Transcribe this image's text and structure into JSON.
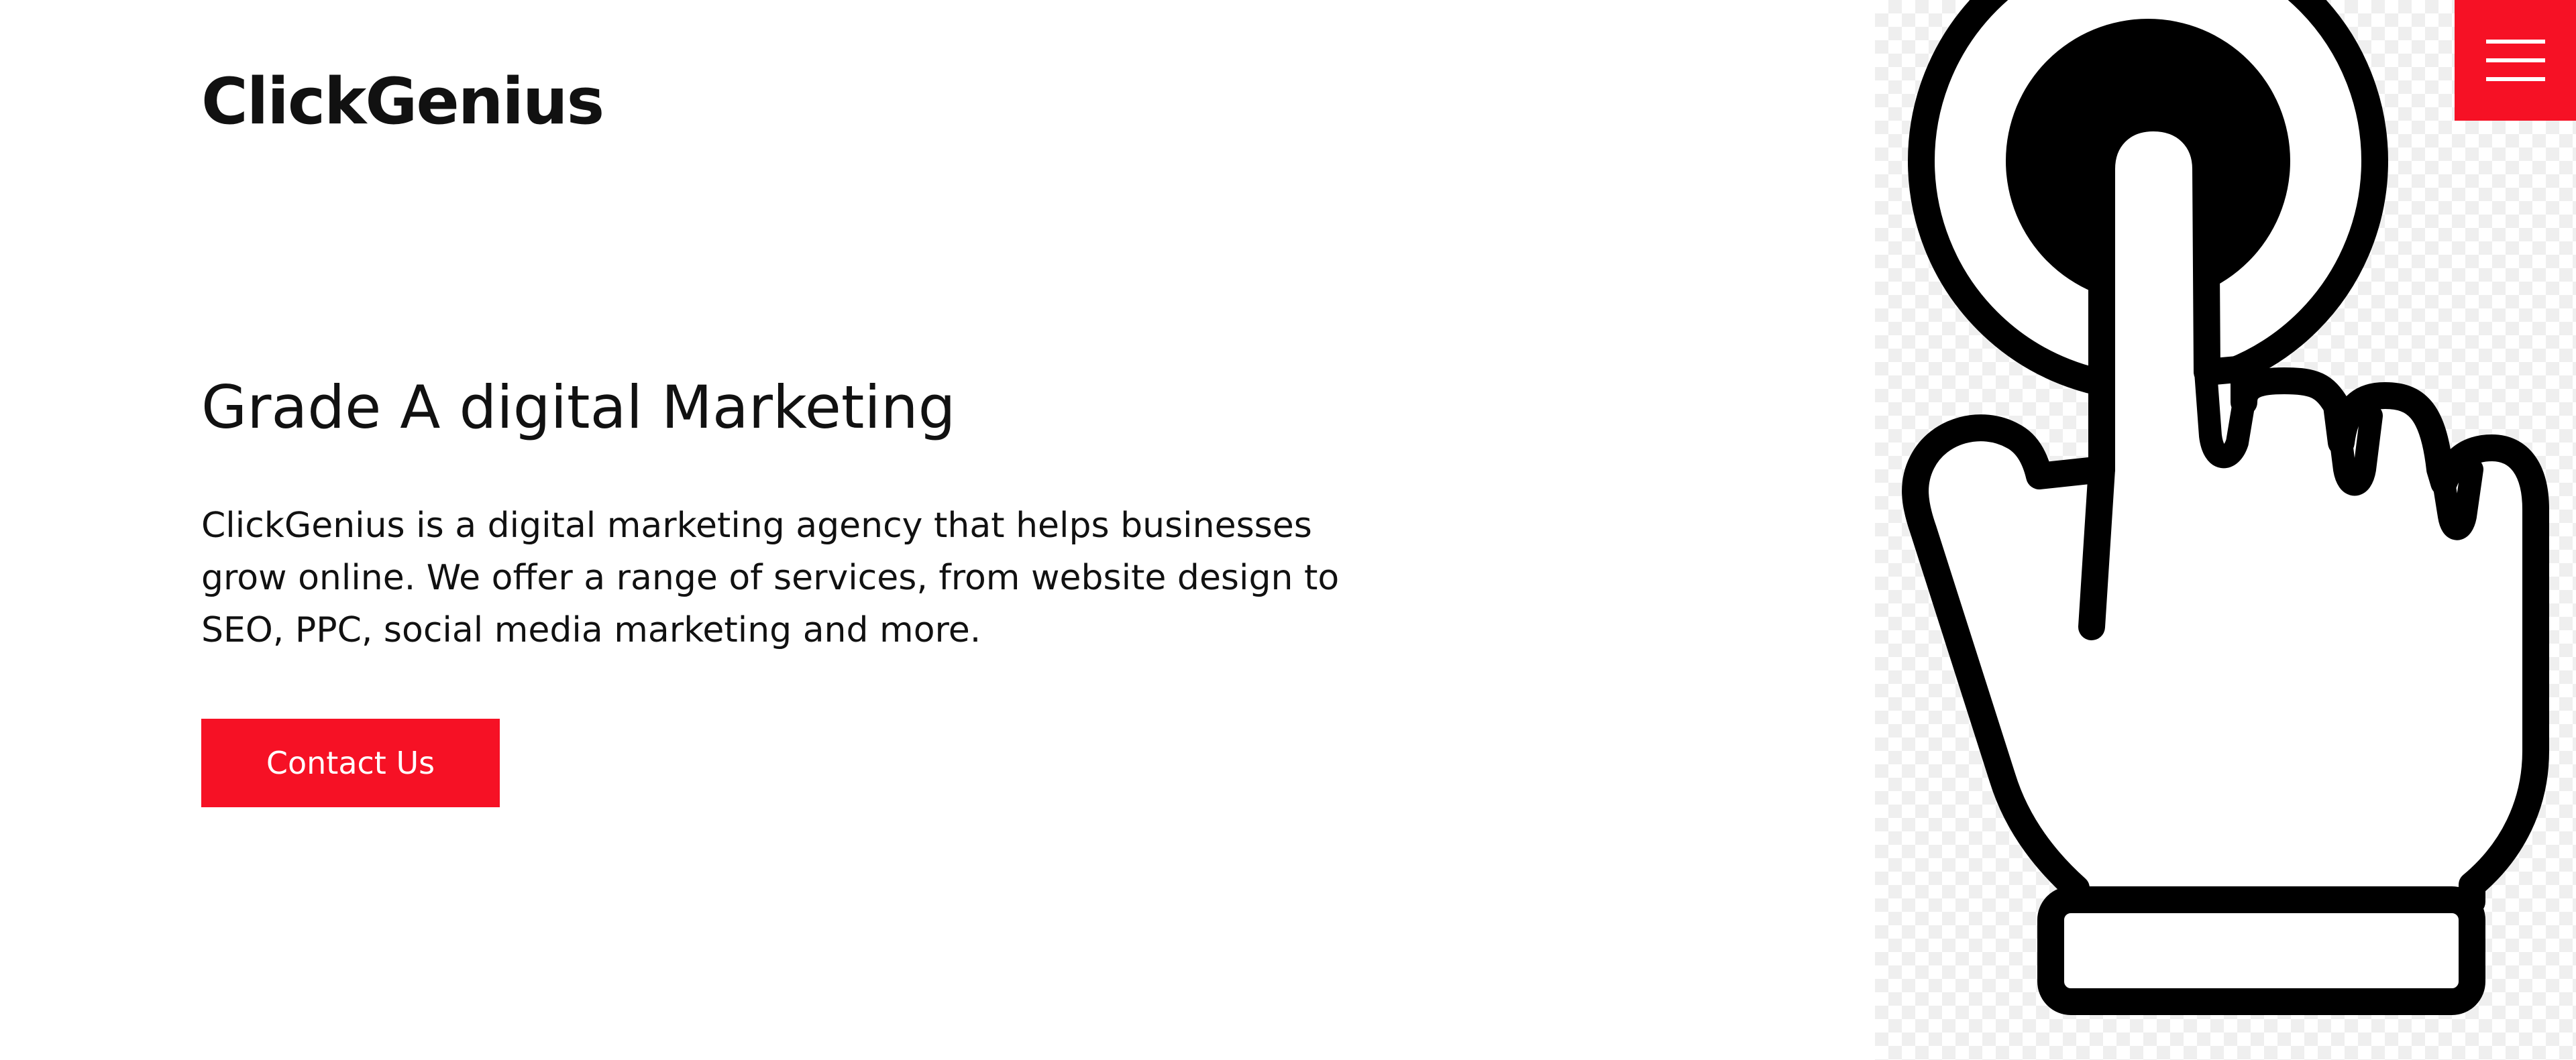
{
  "brand": {
    "name": "ClickGenius"
  },
  "hero": {
    "headline": "Grade A digital Marketing",
    "description": "ClickGenius is a digital marketing agency that helps businesses grow online. We offer a range of services, from website design to SEO, PPC, social media marketing and more.",
    "cta_label": "Contact Us"
  },
  "icons": {
    "hero_illustration": "pointing-hand-click-icon",
    "menu": "hamburger-menu-icon"
  },
  "colors": {
    "accent": "#f61125",
    "text": "#111111",
    "background": "#ffffff"
  }
}
